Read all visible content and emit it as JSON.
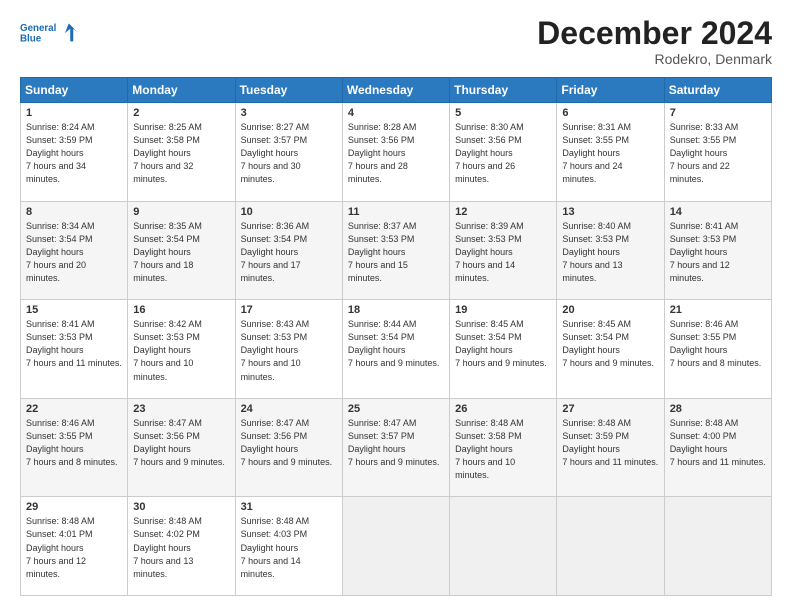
{
  "header": {
    "logo_line1": "General",
    "logo_line2": "Blue",
    "month_title": "December 2024",
    "location": "Rodekro, Denmark"
  },
  "days_of_week": [
    "Sunday",
    "Monday",
    "Tuesday",
    "Wednesday",
    "Thursday",
    "Friday",
    "Saturday"
  ],
  "weeks": [
    [
      {
        "day": "1",
        "sunrise": "8:24 AM",
        "sunset": "3:59 PM",
        "daylight": "7 hours and 34 minutes."
      },
      {
        "day": "2",
        "sunrise": "8:25 AM",
        "sunset": "3:58 PM",
        "daylight": "7 hours and 32 minutes."
      },
      {
        "day": "3",
        "sunrise": "8:27 AM",
        "sunset": "3:57 PM",
        "daylight": "7 hours and 30 minutes."
      },
      {
        "day": "4",
        "sunrise": "8:28 AM",
        "sunset": "3:56 PM",
        "daylight": "7 hours and 28 minutes."
      },
      {
        "day": "5",
        "sunrise": "8:30 AM",
        "sunset": "3:56 PM",
        "daylight": "7 hours and 26 minutes."
      },
      {
        "day": "6",
        "sunrise": "8:31 AM",
        "sunset": "3:55 PM",
        "daylight": "7 hours and 24 minutes."
      },
      {
        "day": "7",
        "sunrise": "8:33 AM",
        "sunset": "3:55 PM",
        "daylight": "7 hours and 22 minutes."
      }
    ],
    [
      {
        "day": "8",
        "sunrise": "8:34 AM",
        "sunset": "3:54 PM",
        "daylight": "7 hours and 20 minutes."
      },
      {
        "day": "9",
        "sunrise": "8:35 AM",
        "sunset": "3:54 PM",
        "daylight": "7 hours and 18 minutes."
      },
      {
        "day": "10",
        "sunrise": "8:36 AM",
        "sunset": "3:54 PM",
        "daylight": "7 hours and 17 minutes."
      },
      {
        "day": "11",
        "sunrise": "8:37 AM",
        "sunset": "3:53 PM",
        "daylight": "7 hours and 15 minutes."
      },
      {
        "day": "12",
        "sunrise": "8:39 AM",
        "sunset": "3:53 PM",
        "daylight": "7 hours and 14 minutes."
      },
      {
        "day": "13",
        "sunrise": "8:40 AM",
        "sunset": "3:53 PM",
        "daylight": "7 hours and 13 minutes."
      },
      {
        "day": "14",
        "sunrise": "8:41 AM",
        "sunset": "3:53 PM",
        "daylight": "7 hours and 12 minutes."
      }
    ],
    [
      {
        "day": "15",
        "sunrise": "8:41 AM",
        "sunset": "3:53 PM",
        "daylight": "7 hours and 11 minutes."
      },
      {
        "day": "16",
        "sunrise": "8:42 AM",
        "sunset": "3:53 PM",
        "daylight": "7 hours and 10 minutes."
      },
      {
        "day": "17",
        "sunrise": "8:43 AM",
        "sunset": "3:53 PM",
        "daylight": "7 hours and 10 minutes."
      },
      {
        "day": "18",
        "sunrise": "8:44 AM",
        "sunset": "3:54 PM",
        "daylight": "7 hours and 9 minutes."
      },
      {
        "day": "19",
        "sunrise": "8:45 AM",
        "sunset": "3:54 PM",
        "daylight": "7 hours and 9 minutes."
      },
      {
        "day": "20",
        "sunrise": "8:45 AM",
        "sunset": "3:54 PM",
        "daylight": "7 hours and 9 minutes."
      },
      {
        "day": "21",
        "sunrise": "8:46 AM",
        "sunset": "3:55 PM",
        "daylight": "7 hours and 8 minutes."
      }
    ],
    [
      {
        "day": "22",
        "sunrise": "8:46 AM",
        "sunset": "3:55 PM",
        "daylight": "7 hours and 8 minutes."
      },
      {
        "day": "23",
        "sunrise": "8:47 AM",
        "sunset": "3:56 PM",
        "daylight": "7 hours and 9 minutes."
      },
      {
        "day": "24",
        "sunrise": "8:47 AM",
        "sunset": "3:56 PM",
        "daylight": "7 hours and 9 minutes."
      },
      {
        "day": "25",
        "sunrise": "8:47 AM",
        "sunset": "3:57 PM",
        "daylight": "7 hours and 9 minutes."
      },
      {
        "day": "26",
        "sunrise": "8:48 AM",
        "sunset": "3:58 PM",
        "daylight": "7 hours and 10 minutes."
      },
      {
        "day": "27",
        "sunrise": "8:48 AM",
        "sunset": "3:59 PM",
        "daylight": "7 hours and 11 minutes."
      },
      {
        "day": "28",
        "sunrise": "8:48 AM",
        "sunset": "4:00 PM",
        "daylight": "7 hours and 11 minutes."
      }
    ],
    [
      {
        "day": "29",
        "sunrise": "8:48 AM",
        "sunset": "4:01 PM",
        "daylight": "7 hours and 12 minutes."
      },
      {
        "day": "30",
        "sunrise": "8:48 AM",
        "sunset": "4:02 PM",
        "daylight": "7 hours and 13 minutes."
      },
      {
        "day": "31",
        "sunrise": "8:48 AM",
        "sunset": "4:03 PM",
        "daylight": "7 hours and 14 minutes."
      },
      null,
      null,
      null,
      null
    ]
  ]
}
